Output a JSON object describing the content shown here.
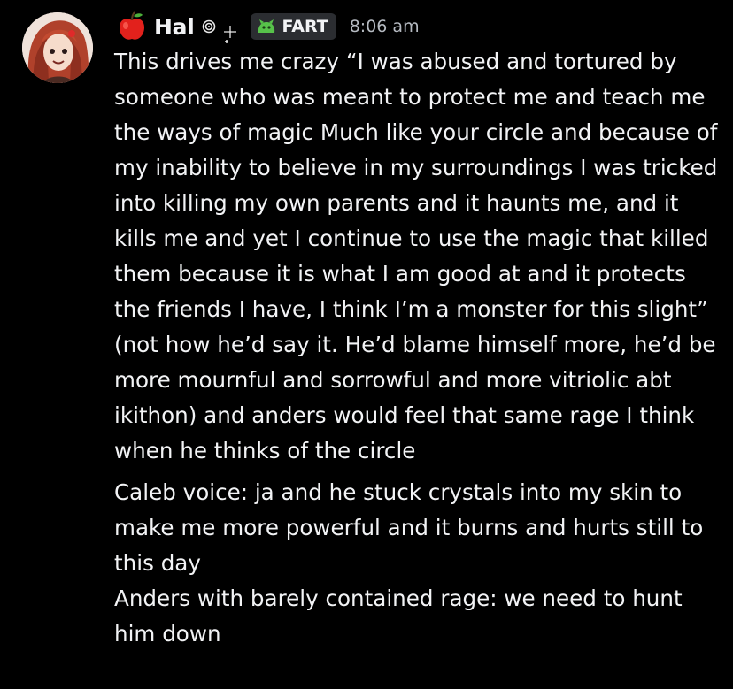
{
  "message": {
    "author": {
      "name": "Hal",
      "role_icon": "apple-icon",
      "status_icons": [
        "spiral-icon",
        "sparkle-icon"
      ],
      "tag_label": "FART",
      "tag_icon": "green-creature-icon"
    },
    "timestamp": "8:06 am",
    "paragraphs": [
      "This drives me crazy “I was abused and tortured by someone who was meant to protect me and teach me the ways of magic Much like your circle and because of my inability to believe in my surroundings I was tricked into killing my own parents and it haunts me, and it kills me and yet I continue to use the magic that killed them because it is what I am good at and it protects the friends I have, I think I’m a monster for this slight” (not how he’d say it. He’d blame himself more, he’d be more mournful and sorrowful and more vitriolic abt ikithon) and anders would feel that same rage I think when he thinks of the circle",
      "Caleb voice: ja and he stuck crystals into my skin to make me more powerful and it burns and hurts still to this day",
      "Anders with barely contained rage: we need to hunt him down"
    ]
  },
  "colors": {
    "background": "#000000",
    "text": "#f2f3f5",
    "muted": "#b5bac1",
    "tag_background": "#2b2d31"
  }
}
